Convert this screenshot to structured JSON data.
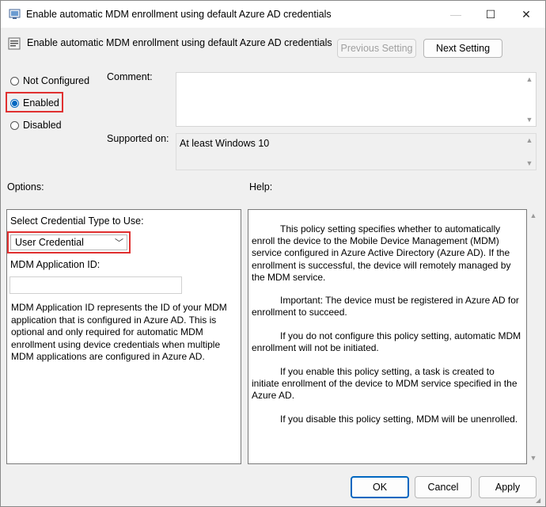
{
  "window": {
    "title": "Enable automatic MDM enrollment using default Azure AD credentials",
    "controls": {
      "minimize": "—",
      "maximize": "☐",
      "close": "✕"
    }
  },
  "header": {
    "setting_name": "Enable automatic MDM enrollment using default Azure AD credentials",
    "prev_label": "Previous Setting",
    "next_label": "Next Setting"
  },
  "state": {
    "options": [
      "Not Configured",
      "Enabled",
      "Disabled"
    ],
    "selected": "Enabled"
  },
  "comment": {
    "label": "Comment:",
    "value": ""
  },
  "supported": {
    "label": "Supported on:",
    "value": "At least Windows 10"
  },
  "options_pane": {
    "title": "Options:",
    "credential_label": "Select Credential Type to Use:",
    "credential_value": "User Credential",
    "app_id_label": "MDM Application ID:",
    "app_id_value": "",
    "description": "MDM Application ID represents the ID of your MDM application that is configured in Azure AD. This is optional and only required for automatic MDM enrollment using device credentials when multiple MDM applications are configured in Azure AD."
  },
  "help_pane": {
    "title": "Help:",
    "paragraphs": [
      "This policy setting specifies whether to automatically enroll the device to the Mobile Device Management (MDM) service configured in Azure Active Directory (Azure AD). If the enrollment is successful, the device will remotely managed by the MDM service.",
      "Important: The device must be registered in Azure AD for enrollment to succeed.",
      "If you do not configure this policy setting, automatic MDM enrollment will not be initiated.",
      "If you enable this policy setting, a task is created to initiate enrollment of the device to MDM service specified in the Azure AD.",
      "If you disable this policy setting, MDM will be unenrolled."
    ]
  },
  "footer": {
    "ok": "OK",
    "cancel": "Cancel",
    "apply": "Apply"
  },
  "colors": {
    "accent": "#0067c0",
    "highlight": "#e03030"
  }
}
